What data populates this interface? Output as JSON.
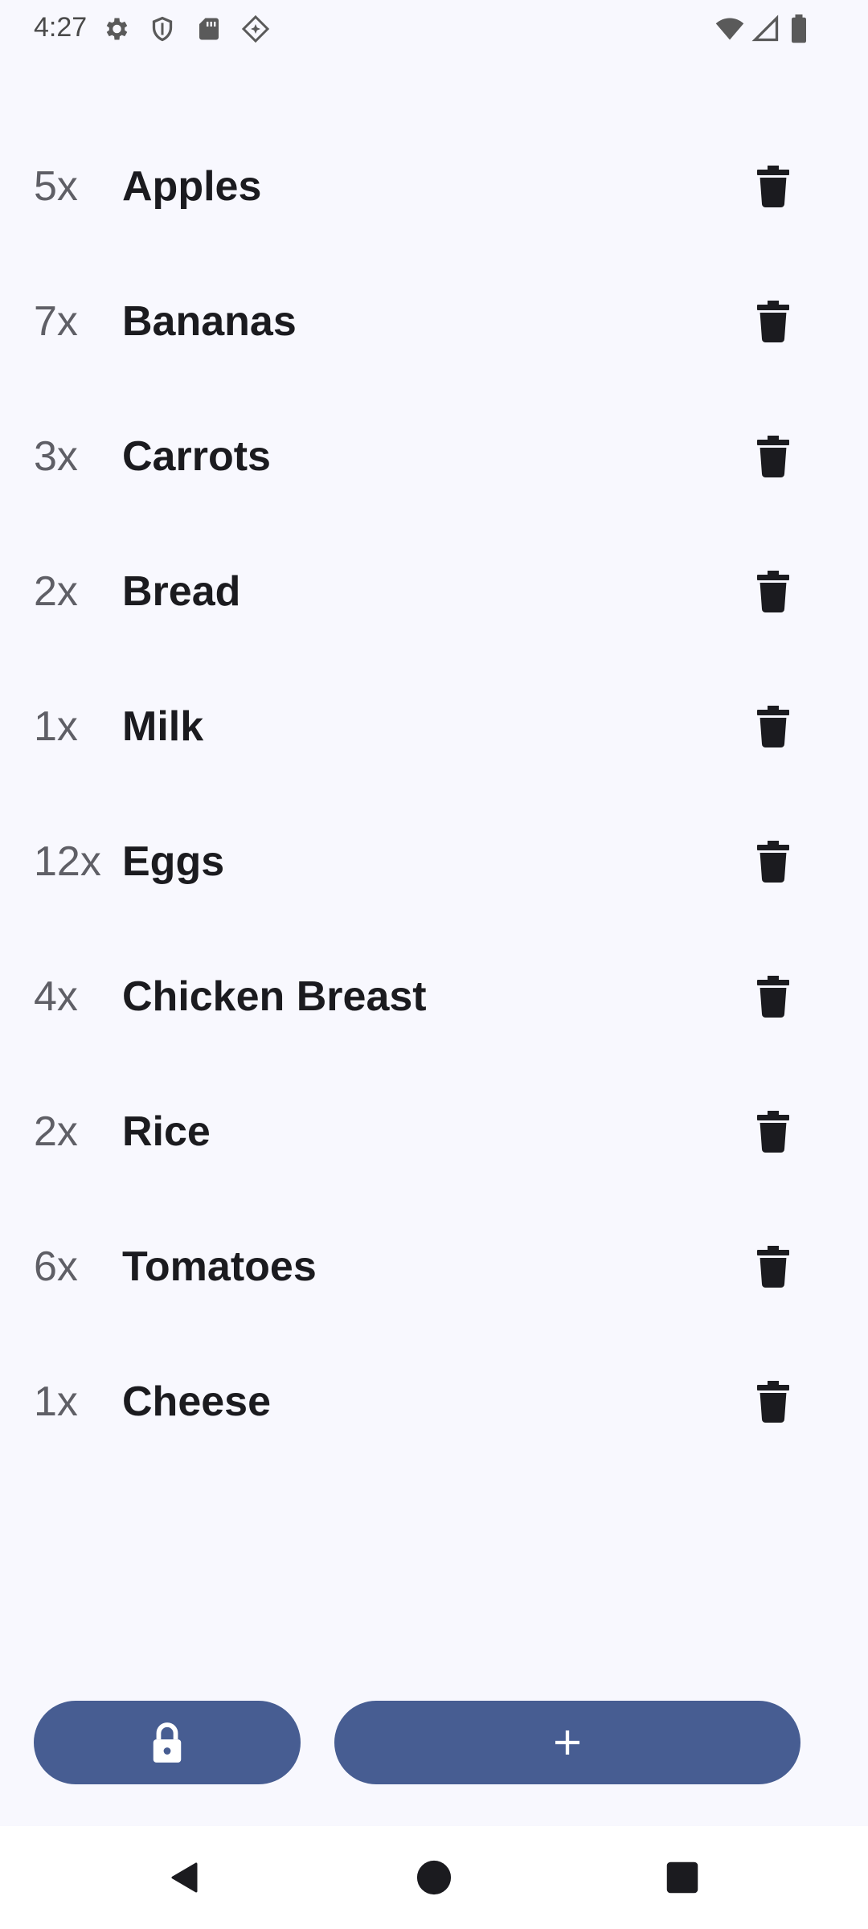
{
  "status_bar": {
    "time": "4:27",
    "left_icons": [
      "gear-icon",
      "shield-icon",
      "sd-card-icon",
      "diamond-icon"
    ],
    "right_icons": [
      "wifi-icon",
      "signal-icon",
      "battery-icon"
    ]
  },
  "grocery_items": [
    {
      "quantity": "5x",
      "name": "Apples"
    },
    {
      "quantity": "7x",
      "name": "Bananas"
    },
    {
      "quantity": "3x",
      "name": "Carrots"
    },
    {
      "quantity": "2x",
      "name": "Bread"
    },
    {
      "quantity": "1x",
      "name": "Milk"
    },
    {
      "quantity": "12x",
      "name": "Eggs"
    },
    {
      "quantity": "4x",
      "name": "Chicken Breast"
    },
    {
      "quantity": "2x",
      "name": "Rice"
    },
    {
      "quantity": "6x",
      "name": "Tomatoes"
    },
    {
      "quantity": "1x",
      "name": "Cheese"
    }
  ],
  "item_action_icon": "trash-icon",
  "bottom_actions": {
    "lock_icon": "lock-icon",
    "add_icon": "plus-icon"
  },
  "navigation": {
    "back_icon": "back-icon",
    "home_icon": "home-icon",
    "recents_icon": "recents-icon"
  },
  "colors": {
    "background": "#f8f8fe",
    "accent": "#475d92",
    "text_primary": "#1b1b1f",
    "text_secondary": "#5f5f66"
  }
}
